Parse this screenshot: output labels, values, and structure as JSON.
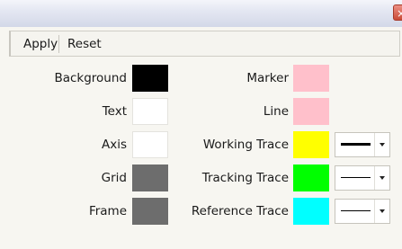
{
  "window": {
    "close_glyph": "×"
  },
  "toolbar": {
    "apply_label": "Apply",
    "reset_label": "Reset"
  },
  "left_colors": [
    {
      "label": "Background",
      "color": "#000000"
    },
    {
      "label": "Text",
      "color": "#ffffff"
    },
    {
      "label": "Axis",
      "color": "#ffffff"
    },
    {
      "label": "Grid",
      "color": "#6d6d6d"
    },
    {
      "label": "Frame",
      "color": "#6d6d6d"
    }
  ],
  "right_colors": [
    {
      "label": "Marker",
      "color": "#ffc0cb"
    },
    {
      "label": "Line",
      "color": "#ffc0cb"
    },
    {
      "label": "Working Trace",
      "color": "#ffff00",
      "line_style": "solid-thick"
    },
    {
      "label": "Tracking Trace",
      "color": "#00ff00",
      "line_style": "solid-thin"
    },
    {
      "label": "Reference Trace",
      "color": "#00ffff",
      "line_style": "solid-thin"
    }
  ]
}
